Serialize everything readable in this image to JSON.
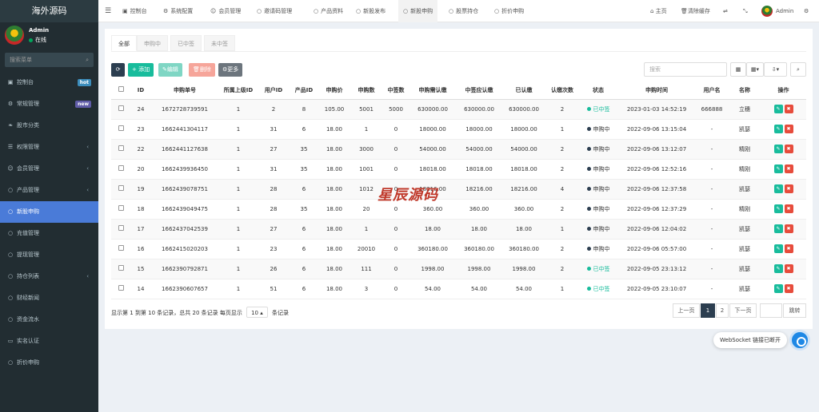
{
  "brand": "海外源码",
  "user": {
    "name": "Admin",
    "status": "在线"
  },
  "sidebar": {
    "search_placeholder": "搜索菜单",
    "items": [
      {
        "label": "控制台",
        "icon": "dashboard-icon",
        "badge": "hot",
        "badge_color": "#3c8dbc"
      },
      {
        "label": "常规管理",
        "icon": "cogs-icon",
        "badge": "new",
        "badge_color": "#605ca8"
      },
      {
        "label": "股市分类",
        "icon": "leaf-icon"
      },
      {
        "label": "权限管理",
        "icon": "group-icon",
        "arrow": true
      },
      {
        "label": "会员管理",
        "icon": "user-icon",
        "arrow": true
      },
      {
        "label": "产品管理",
        "icon": "circle-icon",
        "arrow": true
      },
      {
        "label": "新股申购",
        "icon": "circle-icon",
        "active": true
      },
      {
        "label": "充值管理",
        "icon": "circle-icon"
      },
      {
        "label": "提现管理",
        "icon": "circle-icon"
      },
      {
        "label": "持仓列表",
        "icon": "circle-icon",
        "arrow": true
      },
      {
        "label": "财经新闻",
        "icon": "circle-icon"
      },
      {
        "label": "资金流水",
        "icon": "circle-icon"
      },
      {
        "label": "实名认证",
        "icon": "id-card-icon"
      },
      {
        "label": "折价申购",
        "icon": "circle-icon"
      }
    ]
  },
  "topnav": {
    "tabs": [
      {
        "label": "控制台",
        "icon": "dashboard-icon"
      },
      {
        "label": "系统配置",
        "icon": "gear-icon"
      },
      {
        "label": "会员管理",
        "icon": "user-icon"
      },
      {
        "label": "邀请码管理",
        "icon": "circle-icon"
      },
      {
        "label": "产品资料",
        "icon": "circle-icon"
      },
      {
        "label": "新股发布",
        "icon": "circle-icon"
      },
      {
        "label": "新股申购",
        "icon": "circle-icon",
        "active": true
      },
      {
        "label": "股票持仓",
        "icon": "circle-icon"
      },
      {
        "label": "折价申购",
        "icon": "circle-icon"
      }
    ],
    "home": "主页",
    "clear_cache": "清除缓存",
    "admin": "Admin"
  },
  "subtabs": [
    "全部",
    "申购中",
    "已中签",
    "未中签"
  ],
  "toolbar": {
    "add": "添加",
    "edit": "编辑",
    "delete": "删除",
    "more": "更多",
    "search_placeholder": "搜索"
  },
  "table": {
    "columns": [
      "ID",
      "申购单号",
      "所属上级ID",
      "用户ID",
      "产品ID",
      "申购价",
      "申购数",
      "中签数",
      "申购需认缴",
      "中签应认缴",
      "已认缴",
      "认缴次数",
      "状态",
      "申购时间",
      "用户名",
      "名称",
      "操作"
    ],
    "rows": [
      [
        "24",
        "1672728739591",
        "1",
        "2",
        "8",
        "105.00",
        "5001",
        "5000",
        "630000.00",
        "630000.00",
        "630000.00",
        "2",
        "已中签",
        "2023-01-03 14:52:19",
        "666888",
        "立穗"
      ],
      [
        "23",
        "1662441304117",
        "1",
        "31",
        "6",
        "18.00",
        "1",
        "0",
        "18000.00",
        "18000.00",
        "18000.00",
        "1",
        "申购中",
        "2022-09-06 13:15:04",
        "-",
        "凯瑟"
      ],
      [
        "22",
        "1662441127638",
        "1",
        "27",
        "35",
        "18.00",
        "3000",
        "0",
        "54000.00",
        "54000.00",
        "54000.00",
        "2",
        "申购中",
        "2022-09-06 13:12:07",
        "-",
        "精刚"
      ],
      [
        "20",
        "1662439936450",
        "1",
        "31",
        "35",
        "18.00",
        "1001",
        "0",
        "18018.00",
        "18018.00",
        "18018.00",
        "2",
        "申购中",
        "2022-09-06 12:52:16",
        "-",
        "精刚"
      ],
      [
        "19",
        "1662439078751",
        "1",
        "28",
        "6",
        "18.00",
        "1012",
        "0",
        "18216.00",
        "18216.00",
        "18216.00",
        "4",
        "申购中",
        "2022-09-06 12:37:58",
        "-",
        "凯瑟"
      ],
      [
        "18",
        "1662439049475",
        "1",
        "28",
        "35",
        "18.00",
        "20",
        "0",
        "360.00",
        "360.00",
        "360.00",
        "2",
        "申购中",
        "2022-09-06 12:37:29",
        "-",
        "精刚"
      ],
      [
        "17",
        "1662437042539",
        "1",
        "27",
        "6",
        "18.00",
        "1",
        "0",
        "18.00",
        "18.00",
        "18.00",
        "1",
        "申购中",
        "2022-09-06 12:04:02",
        "-",
        "凯瑟"
      ],
      [
        "16",
        "1662415020203",
        "1",
        "23",
        "6",
        "18.00",
        "20010",
        "0",
        "360180.00",
        "360180.00",
        "360180.00",
        "2",
        "申购中",
        "2022-09-06 05:57:00",
        "-",
        "凯瑟"
      ],
      [
        "15",
        "1662390792871",
        "1",
        "26",
        "6",
        "18.00",
        "111",
        "0",
        "1998.00",
        "1998.00",
        "1998.00",
        "2",
        "已中签",
        "2022-09-05 23:13:12",
        "-",
        "凯瑟"
      ],
      [
        "14",
        "1662390607657",
        "1",
        "51",
        "6",
        "18.00",
        "3",
        "0",
        "54.00",
        "54.00",
        "54.00",
        "1",
        "已中签",
        "2022-09-05 23:10:07",
        "-",
        "凯瑟"
      ]
    ]
  },
  "footer": {
    "summary": "显示第 1 到第 10 条记录，总共 20 条记录 每页显示",
    "page_size": "10",
    "suffix": "条记录",
    "prev": "上一页",
    "pages": [
      "1",
      "2"
    ],
    "next": "下一页",
    "jump": "跳转"
  },
  "watermark": "星辰源码",
  "websocket": "WebSocket 链接已断开",
  "colors": {
    "accent": "#18bc9c",
    "sidebar": "#222d32",
    "active_menu": "#4a7bd8",
    "danger": "#e74c3c"
  }
}
